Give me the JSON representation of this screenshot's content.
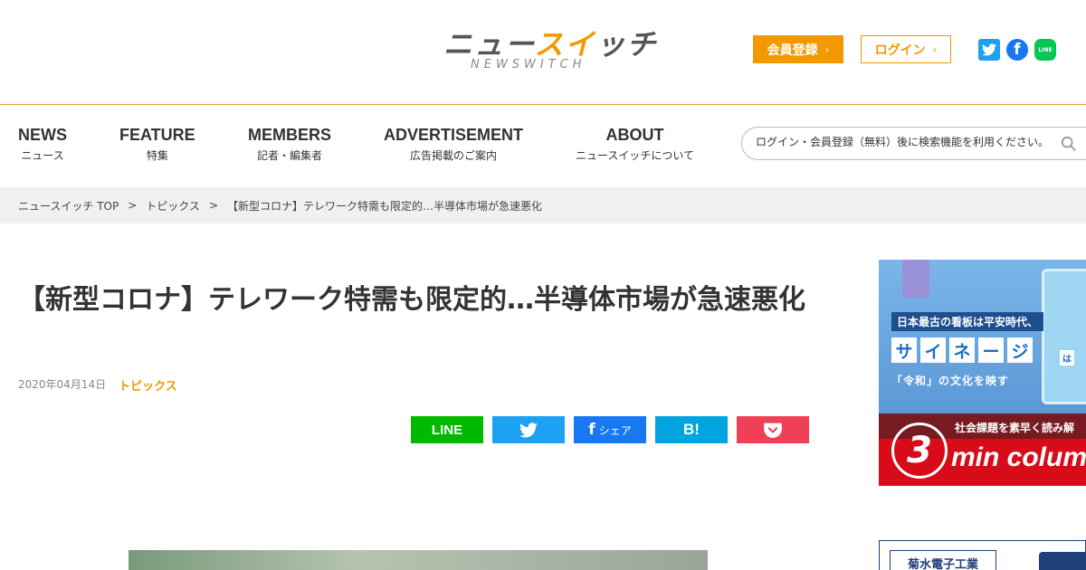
{
  "header": {
    "logo_main_prefix": "ニュー",
    "logo_main_accent": "スイ",
    "logo_main_suffix": "ッチ",
    "logo_sub": "NEWSWITCH",
    "register_label": "会員登録",
    "login_label": "ログイン",
    "chevron": "›",
    "sns": {
      "twitter_icon": "twitter-icon",
      "facebook_icon": "facebook-icon",
      "line_icon": "line-icon",
      "facebook_glyph": "f",
      "line_glyph": "LINE"
    }
  },
  "nav": {
    "items": [
      {
        "en": "NEWS",
        "ja": "ニュース"
      },
      {
        "en": "FEATURE",
        "ja": "特集"
      },
      {
        "en": "MEMBERS",
        "ja": "記者・編集者"
      },
      {
        "en": "ADVERTISEMENT",
        "ja": "広告掲載のご案内"
      },
      {
        "en": "ABOUT",
        "ja": "ニュースイッチについて"
      }
    ],
    "search_placeholder": "ログイン・会員登録（無料）後に検索機能を利用ください。"
  },
  "breadcrumb": {
    "items": [
      "ニュースイッチ TOP",
      "トピックス",
      "【新型コロナ】テレワーク特需も限定的…半導体市場が急速悪化"
    ],
    "separator": ">"
  },
  "article": {
    "title": "【新型コロナ】テレワーク特需も限定的…半導体市場が急速悪化",
    "date": "2020年04月14日",
    "category": "トピックス"
  },
  "share": {
    "line_label": "LINE",
    "facebook_glyph": "f",
    "facebook_label": "シェア",
    "hatena_label": "B!"
  },
  "sidebar": {
    "ad1": {
      "line1": "日本最古の看板は平安時代、",
      "signage_chars": [
        "サ",
        "イ",
        "ネ",
        "ー",
        "ジ"
      ],
      "ha": "は",
      "line3": "「令和」の文化を映す",
      "tag": "社会課題を素早く読み解",
      "number": "3",
      "min_column": "min colum"
    },
    "ad2": {
      "company": "菊水電子工業"
    }
  },
  "colors": {
    "accent": "#f39800",
    "line": "#00b900",
    "twitter": "#1da1f2",
    "facebook": "#1877f2",
    "hatena": "#00a4de",
    "pocket": "#ef4056"
  }
}
